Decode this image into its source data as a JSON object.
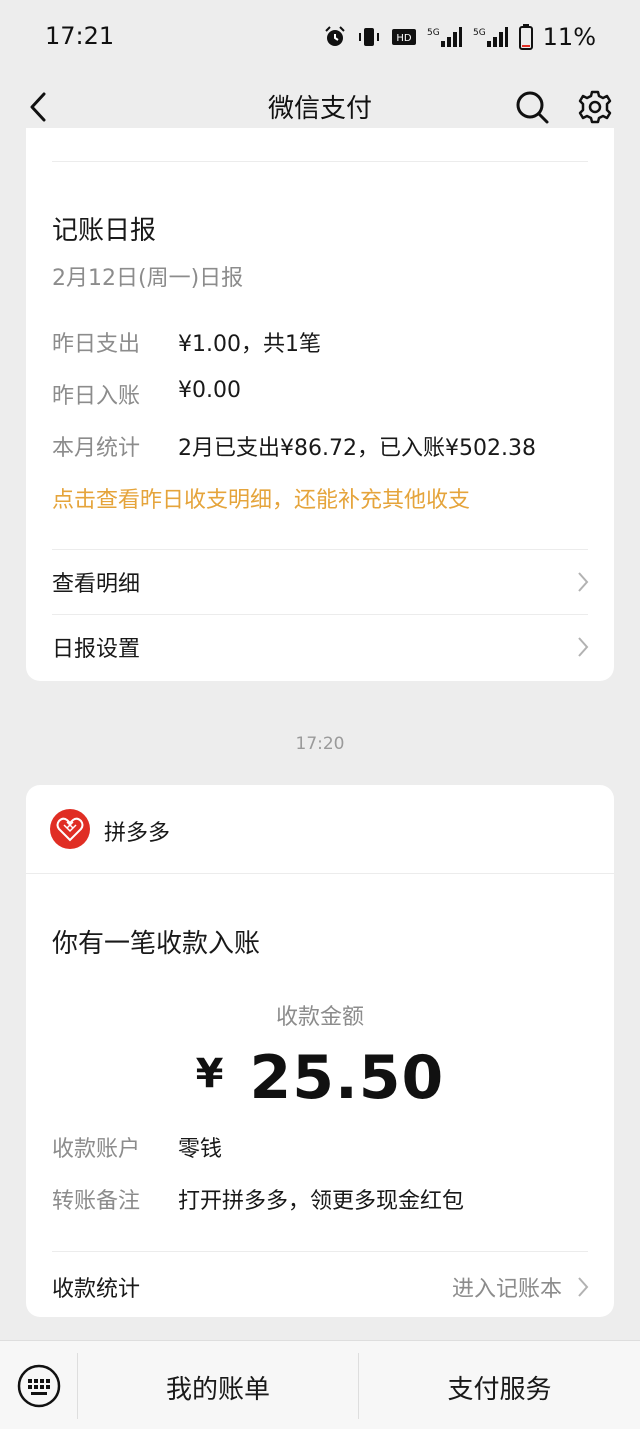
{
  "status_bar": {
    "time": "17:21",
    "battery": "11%",
    "icons": [
      "alarm-icon",
      "vibrate-icon",
      "hd-icon",
      "signal-5g-icon",
      "signal-5g-icon",
      "battery-icon"
    ]
  },
  "nav": {
    "title": "微信支付",
    "icons": [
      "back-icon",
      "search-icon",
      "gear-icon"
    ]
  },
  "daily_report": {
    "title": "记账日报",
    "subtitle": "2月12日(周一)日报",
    "rows": [
      {
        "label": "昨日支出",
        "value": "¥1.00，共1笔"
      },
      {
        "label": "昨日入账",
        "value": "¥0.00"
      },
      {
        "label": "本月统计",
        "value": "2月已支出¥86.72，已入账¥502.38"
      }
    ],
    "link": "点击查看昨日收支明细，还能补充其他收支",
    "menu": [
      {
        "label": "查看明细"
      },
      {
        "label": "日报设置"
      }
    ]
  },
  "timestamp": "17:20",
  "payment_card": {
    "merchant": "拼多多",
    "title": "你有一笔收款入账",
    "amount_label": "收款金额",
    "currency": "¥",
    "amount": "25.50",
    "rows": [
      {
        "label": "收款账户",
        "value": "零钱"
      },
      {
        "label": "转账备注",
        "value": "打开拼多多，领更多现金红包"
      }
    ],
    "stat_label": "收款统计",
    "stat_link": "进入记账本"
  },
  "bottom_bar": {
    "bill": "我的账单",
    "service": "支付服务"
  },
  "colors": {
    "accent_orange": "#e5a43b",
    "pdd_red": "#e02e24",
    "background": "#ededed"
  }
}
